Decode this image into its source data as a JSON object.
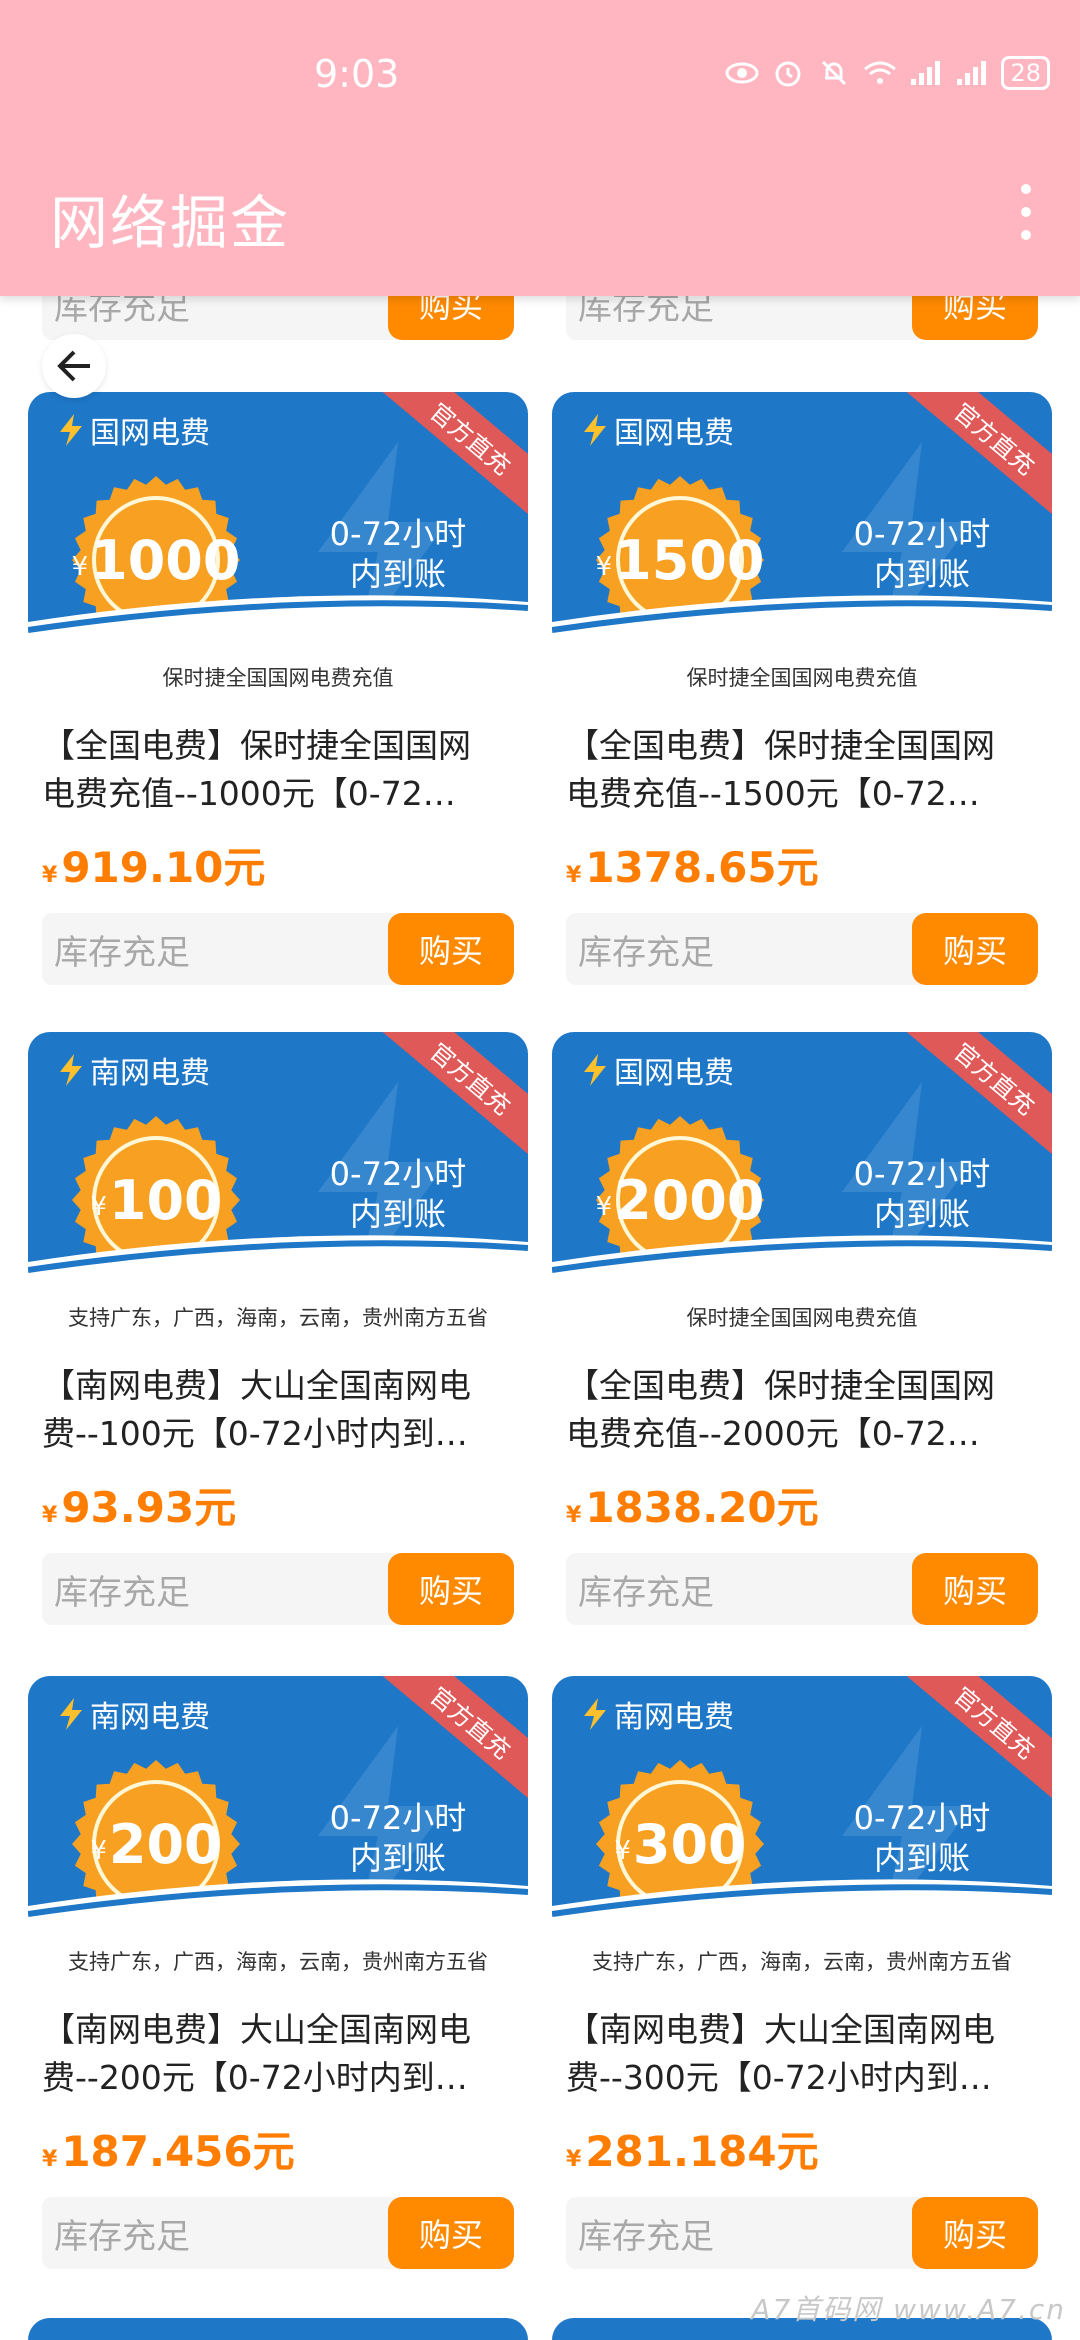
{
  "status_bar": {
    "time": "9:03",
    "battery": "28"
  },
  "app_bar": {
    "title": "网络掘金"
  },
  "stock_label": "库存充足",
  "buy_label": "购买",
  "ribbon_label": "官方直充",
  "delivery_label_line1": "0-72小时",
  "delivery_label_line2": "内到账",
  "currency_symbol": "¥",
  "products": [
    {
      "category": "国网电费",
      "amount": "1000",
      "caption": "保时捷全国国网电费充值",
      "title_line1": "【全国电费】保时捷全国国网",
      "title_line2": "电费充值--1000元【0-72…",
      "price": "919.10元"
    },
    {
      "category": "国网电费",
      "amount": "1500",
      "caption": "保时捷全国国网电费充值",
      "title_line1": "【全国电费】保时捷全国国网",
      "title_line2": "电费充值--1500元【0-72…",
      "price": "1378.65元"
    },
    {
      "category": "南网电费",
      "amount": "100",
      "caption": "支持广东，广西，海南，云南，贵州南方五省",
      "title_line1": "【南网电费】大山全国南网电",
      "title_line2": "费--100元【0-72小时内到…",
      "price": "93.93元"
    },
    {
      "category": "国网电费",
      "amount": "2000",
      "caption": "保时捷全国国网电费充值",
      "title_line1": "【全国电费】保时捷全国国网",
      "title_line2": "电费充值--2000元【0-72…",
      "price": "1838.20元"
    },
    {
      "category": "南网电费",
      "amount": "200",
      "caption": "支持广东，广西，海南，云南，贵州南方五省",
      "title_line1": "【南网电费】大山全国南网电",
      "title_line2": "费--200元【0-72小时内到…",
      "price": "187.456元"
    },
    {
      "category": "南网电费",
      "amount": "300",
      "caption": "支持广东，广西，海南，云南，贵州南方五省",
      "title_line1": "【南网电费】大山全国南网电",
      "title_line2": "费--300元【0-72小时内到…",
      "price": "281.184元"
    }
  ],
  "watermark": "A7首码网 www.A7.cn",
  "colors": {
    "appbar": "#ffb6c1",
    "banner": "#1e77c7",
    "accent": "#ff8a00",
    "price": "#ff7d00",
    "ribbon": "#e05959"
  },
  "icons": [
    "eye-icon",
    "alarm-icon",
    "mute-icon",
    "wifi-icon",
    "signal-icon",
    "battery-icon",
    "more-vert-icon",
    "back-arrow-icon",
    "bolt-icon"
  ]
}
